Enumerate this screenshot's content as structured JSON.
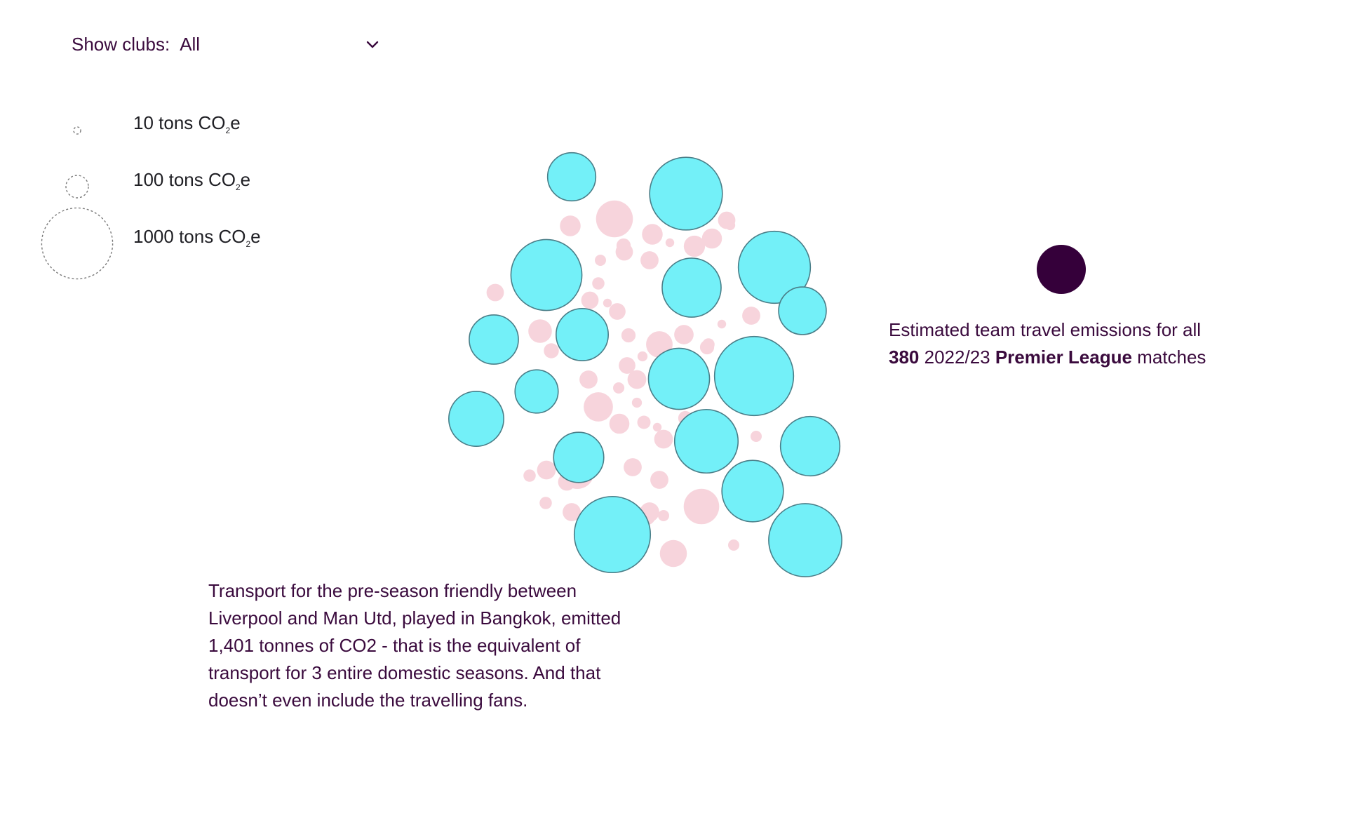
{
  "filter": {
    "label": "Show clubs:",
    "selected": "All",
    "chevron_icon": "chevron-down-icon"
  },
  "legend": {
    "items": [
      {
        "value": 10,
        "prefix": "10 tons CO",
        "sub": "2",
        "suffix": "e"
      },
      {
        "value": 100,
        "prefix": "100 tons CO",
        "sub": "2",
        "suffix": "e"
      },
      {
        "value": 1000,
        "prefix": "1000 tons CO",
        "sub": "2",
        "suffix": "e"
      }
    ]
  },
  "summary": {
    "line1": "Estimated team travel emissions for all",
    "count": "380",
    "season": "2022/23",
    "league": "Premier League",
    "tail": "matches"
  },
  "annotation": {
    "text": "Transport for the pre-season friendly between Liverpool and Man Utd, played in Bangkok, emitted 1,401 tonnes of CO2 - that is the equivalent of transport for 3 entire domestic seasons. And that doesn’t even include the travelling fans."
  },
  "colors": {
    "highlight": "#73f0f8",
    "highlight_stroke": "#4a7e88",
    "match": "#f7d4dc",
    "summary_dot": "#35003a",
    "text": "#3a0a3d"
  },
  "chart_data": {
    "type": "bubble",
    "unit": "tons CO2e",
    "highlighted_matches_tons": [
      460,
      1050,
      1000,
      1030,
      690,
      450,
      540,
      480,
      1240,
      370,
      740,
      600,
      800,
      700,
      500,
      750,
      1060,
      1150,
      330,
      1060
    ],
    "other_matches_tons": [
      85,
      270,
      60,
      85,
      15,
      65,
      80,
      60,
      90,
      20,
      25,
      40,
      30,
      15,
      60,
      55,
      60,
      110,
      40,
      75,
      20,
      40,
      15,
      65,
      20,
      45,
      55,
      20,
      140,
      30,
      70,
      65,
      20,
      20,
      25,
      170,
      35,
      80,
      40,
      70,
      25,
      20,
      70,
      65,
      110,
      30,
      65,
      25,
      75,
      60,
      225,
      250,
      145,
      25,
      50,
      75,
      30,
      25,
      15,
      30,
      65,
      35
    ]
  }
}
